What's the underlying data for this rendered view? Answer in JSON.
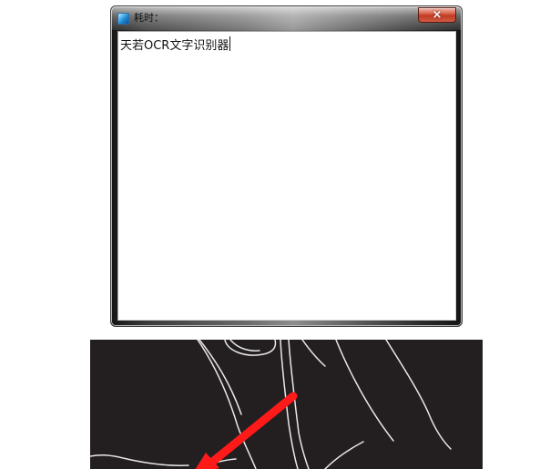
{
  "window": {
    "title": "耗时：",
    "close_label": "×",
    "colors": {
      "close_button": "#c23a22",
      "frame": "#2f2f2f",
      "client_bg": "#ffffff"
    }
  },
  "editor": {
    "text": "天若OCR文字识别器"
  },
  "preview": {
    "background": "#231f20",
    "arrow_color": "#ff1a1a"
  }
}
